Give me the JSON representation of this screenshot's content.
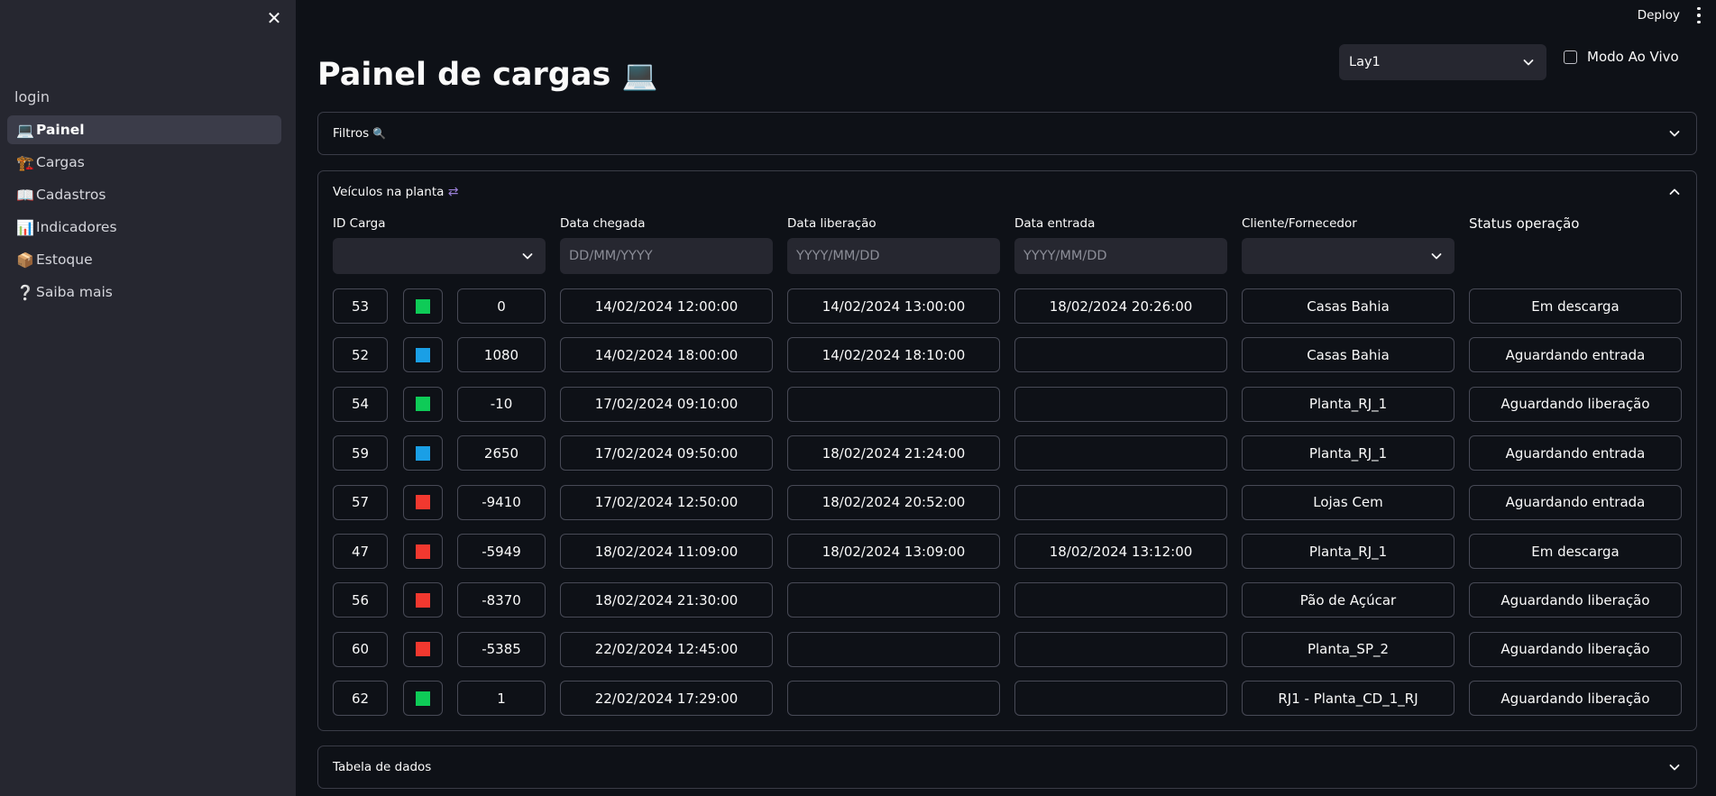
{
  "sidebar": {
    "login_label": "login",
    "items": [
      {
        "icon": "💻",
        "icon_name": "laptop-icon",
        "label": "Painel",
        "active": true
      },
      {
        "icon": "🏗️",
        "icon_name": "crane-icon",
        "label": "Cargas"
      },
      {
        "icon": "📖",
        "icon_name": "open-book-icon",
        "label": "Cadastros"
      },
      {
        "icon": "📊",
        "icon_name": "bar-chart-icon",
        "label": "Indicadores"
      },
      {
        "icon": "📦",
        "icon_name": "package-icon",
        "label": "Estoque"
      },
      {
        "icon": "❔",
        "icon_name": "question-icon",
        "label": "Saiba mais"
      }
    ]
  },
  "topbar": {
    "deploy_label": "Deploy"
  },
  "page": {
    "title": "Painel de cargas",
    "title_icon": "💻"
  },
  "layout_select": {
    "value": "Lay1"
  },
  "live_mode": {
    "label": "Modo Ao Vivo",
    "checked": false
  },
  "filters_expander": {
    "label": "Filtros",
    "icon": "🔍"
  },
  "vehicles_expander": {
    "label": "Veículos na planta",
    "icon": "⇄"
  },
  "table_expander": {
    "label": "Tabela de dados"
  },
  "columns": {
    "id": "ID Carga",
    "arrival": "Data chegada",
    "release": "Data liberação",
    "entry": "Data entrada",
    "client": "Cliente/Fornecedor",
    "status": "Status operação"
  },
  "filter_placeholders": {
    "arrival": "DD/MM/YYYY",
    "release": "YYYY/MM/DD",
    "entry": "YYYY/MM/DD"
  },
  "colors": {
    "green": "#0ecb57",
    "blue": "#1a9fe6",
    "red": "#f2382f"
  },
  "rows": [
    {
      "id": "53",
      "color": "green",
      "delta": "0",
      "arrival": "14/02/2024 12:00:00",
      "release": "14/02/2024 13:00:00",
      "entry": "18/02/2024 20:26:00",
      "client": "Casas Bahia",
      "status": "Em descarga"
    },
    {
      "id": "52",
      "color": "blue",
      "delta": "1080",
      "arrival": "14/02/2024 18:00:00",
      "release": "14/02/2024 18:10:00",
      "entry": "",
      "client": "Casas Bahia",
      "status": "Aguardando entrada"
    },
    {
      "id": "54",
      "color": "green",
      "delta": "-10",
      "arrival": "17/02/2024 09:10:00",
      "release": "",
      "entry": "",
      "client": "Planta_RJ_1",
      "status": "Aguardando liberação"
    },
    {
      "id": "59",
      "color": "blue",
      "delta": "2650",
      "arrival": "17/02/2024 09:50:00",
      "release": "18/02/2024 21:24:00",
      "entry": "",
      "client": "Planta_RJ_1",
      "status": "Aguardando entrada"
    },
    {
      "id": "57",
      "color": "red",
      "delta": "-9410",
      "arrival": "17/02/2024 12:50:00",
      "release": "18/02/2024 20:52:00",
      "entry": "",
      "client": "Lojas Cem",
      "status": "Aguardando entrada"
    },
    {
      "id": "47",
      "color": "red",
      "delta": "-5949",
      "arrival": "18/02/2024 11:09:00",
      "release": "18/02/2024 13:09:00",
      "entry": "18/02/2024 13:12:00",
      "client": "Planta_RJ_1",
      "status": "Em descarga"
    },
    {
      "id": "56",
      "color": "red",
      "delta": "-8370",
      "arrival": "18/02/2024 21:30:00",
      "release": "",
      "entry": "",
      "client": "Pão de Açúcar",
      "status": "Aguardando liberação"
    },
    {
      "id": "60",
      "color": "red",
      "delta": "-5385",
      "arrival": "22/02/2024 12:45:00",
      "release": "",
      "entry": "",
      "client": "Planta_SP_2",
      "status": "Aguardando liberação"
    },
    {
      "id": "62",
      "color": "green",
      "delta": "1",
      "arrival": "22/02/2024 17:29:00",
      "release": "",
      "entry": "",
      "client": "RJ1 - Planta_CD_1_RJ",
      "status": "Aguardando liberação"
    }
  ]
}
